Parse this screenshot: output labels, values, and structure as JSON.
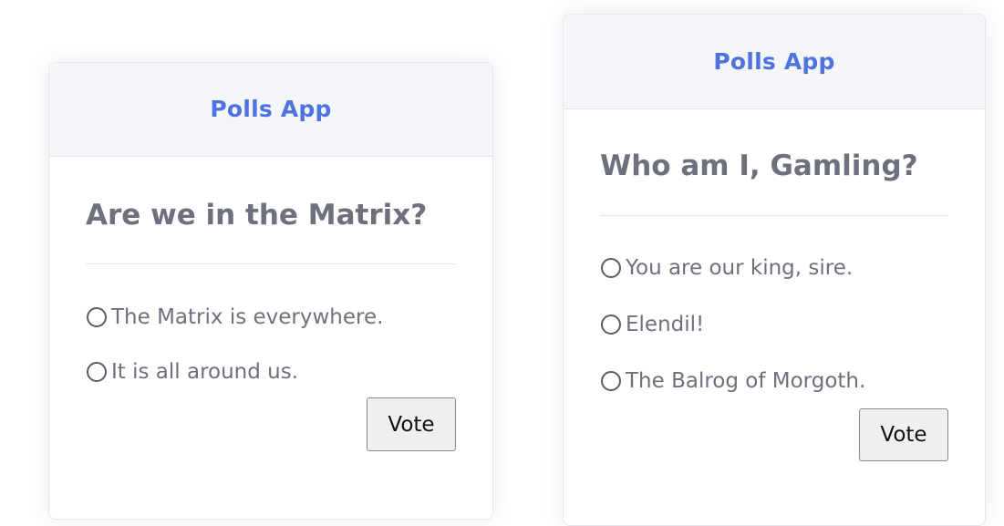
{
  "polls": [
    {
      "header_title": "Polls App",
      "question": "Are we in the Matrix?",
      "options": [
        "The Matrix is everywhere.",
        "It is all around us."
      ],
      "vote_label": "Vote"
    },
    {
      "header_title": "Polls App",
      "question": "Who am I, Gamling?",
      "options": [
        "You are our king, sire.",
        "Elendil!",
        "The Balrog of Morgoth."
      ],
      "vote_label": "Vote"
    }
  ],
  "colors": {
    "header_text": "#4e73df",
    "header_bg": "#f5f6fa",
    "body_text": "#6e707e"
  }
}
